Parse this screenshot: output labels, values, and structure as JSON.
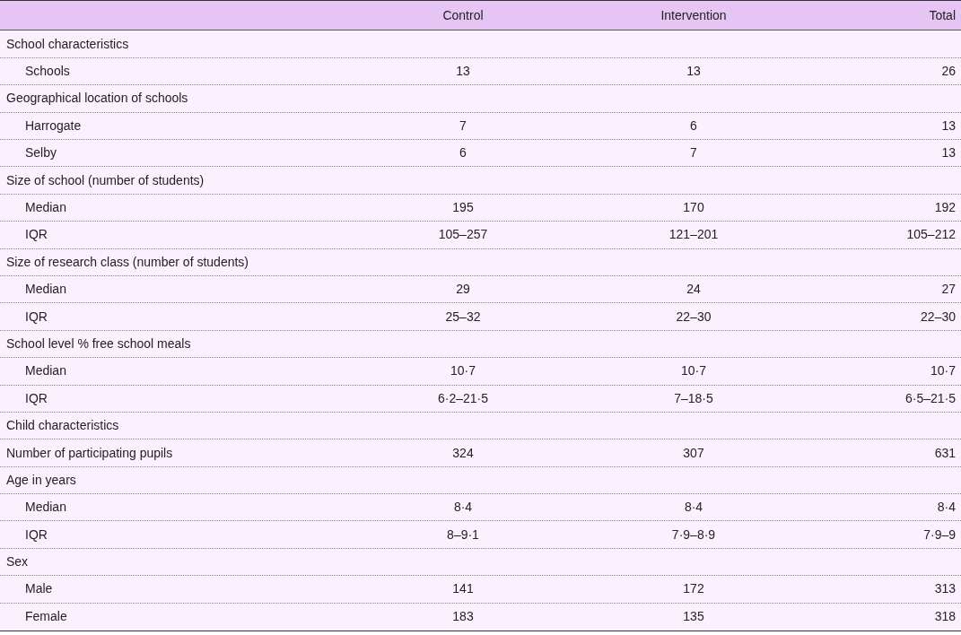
{
  "columns": [
    "",
    "Control",
    "Intervention",
    "Total"
  ],
  "rows": [
    {
      "label": "School characteristics",
      "children": [
        {
          "label": "Schools",
          "values": [
            "13",
            "13",
            "26"
          ]
        }
      ]
    },
    {
      "label": "Geographical location of schools",
      "children": [
        {
          "label": "Harrogate",
          "values": [
            "7",
            "6",
            "13"
          ]
        },
        {
          "label": "Selby",
          "values": [
            "6",
            "7",
            "13"
          ]
        }
      ]
    },
    {
      "label": "Size of school (number of students)",
      "children": [
        {
          "label": "Median",
          "values": [
            "195",
            "170",
            "192"
          ]
        },
        {
          "label": "IQR",
          "values": [
            "105–257",
            "121–201",
            "105–212"
          ]
        }
      ]
    },
    {
      "label": "Size of research class (number of students)",
      "children": [
        {
          "label": "Median",
          "values": [
            "29",
            "24",
            "27"
          ]
        },
        {
          "label": "IQR",
          "values": [
            "25–32",
            "22–30",
            "22–30"
          ]
        }
      ]
    },
    {
      "label": "School level % free school meals",
      "children": [
        {
          "label": "Median",
          "values": [
            "10·7",
            "10·7",
            "10·7"
          ]
        },
        {
          "label": "IQR",
          "values": [
            "6·2–21·5",
            "7–18·5",
            "6·5–21·5"
          ]
        }
      ]
    },
    {
      "label": "Child characteristics"
    },
    {
      "label": "Number of participating pupils",
      "values": [
        "324",
        "307",
        "631"
      ]
    },
    {
      "label": "Age in years",
      "children": [
        {
          "label": "Median",
          "values": [
            "8·4",
            "8·4",
            "8·4"
          ]
        },
        {
          "label": "IQR",
          "values": [
            "8–9·1",
            "7·9–8·9",
            "7·9–9"
          ]
        }
      ]
    },
    {
      "label": "Sex",
      "children": [
        {
          "label": "Male",
          "values": [
            "141",
            "172",
            "313"
          ]
        },
        {
          "label": "Female",
          "values": [
            "183",
            "135",
            "318"
          ]
        }
      ]
    }
  ]
}
